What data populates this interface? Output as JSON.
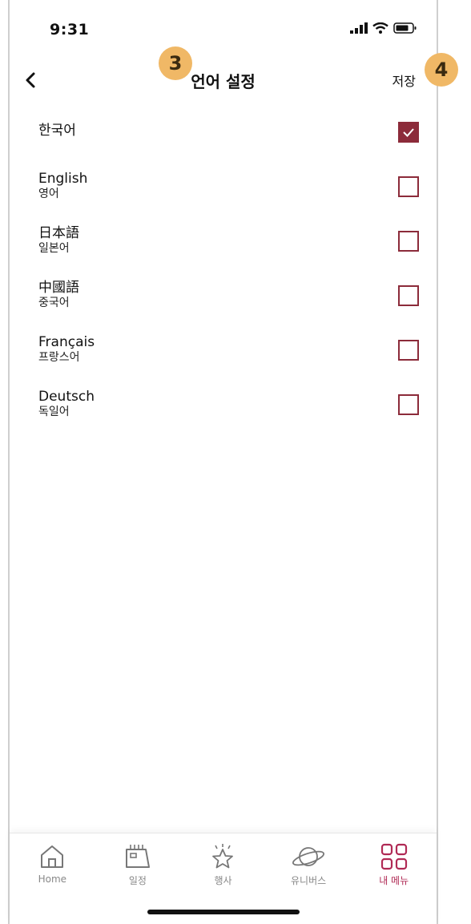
{
  "status_bar": {
    "time": "9:31"
  },
  "header": {
    "title": "언어 설정",
    "save_label": "저장"
  },
  "badges": {
    "title_badge": "3",
    "save_badge": "4"
  },
  "languages": [
    {
      "name": "한국어",
      "sub": "",
      "checked": true
    },
    {
      "name": "English",
      "sub": "영어",
      "checked": false
    },
    {
      "name": "日本語",
      "sub": "일본어",
      "checked": false
    },
    {
      "name": "中國語",
      "sub": "중국어",
      "checked": false
    },
    {
      "name": "Français",
      "sub": "프랑스어",
      "checked": false
    },
    {
      "name": "Deutsch",
      "sub": "독일어",
      "checked": false
    }
  ],
  "tabbar": {
    "items": [
      {
        "label": "Home",
        "icon": "home-icon"
      },
      {
        "label": "일정",
        "icon": "calendar-icon"
      },
      {
        "label": "행사",
        "icon": "star-icon"
      },
      {
        "label": "유니버스",
        "icon": "planet-icon"
      },
      {
        "label": "내 메뉴",
        "icon": "grid-icon",
        "active": true
      }
    ]
  },
  "colors": {
    "accent": "#8c2b3a",
    "active_tab": "#b02a55",
    "badge": "#f0b866"
  }
}
